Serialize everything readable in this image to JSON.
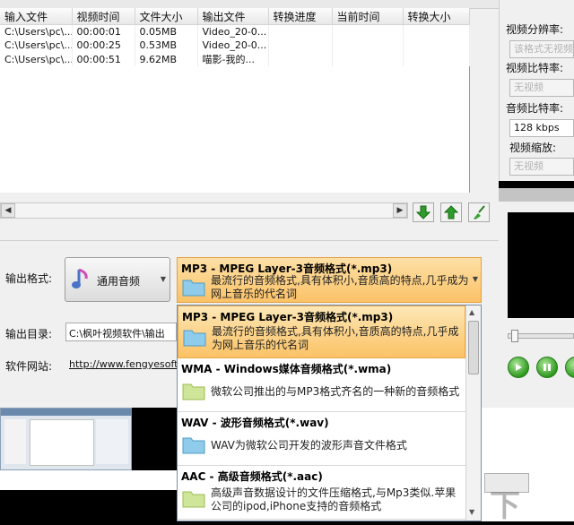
{
  "file_table": {
    "columns": [
      "输入文件",
      "视频时间",
      "文件大小",
      "输出文件",
      "转换进度",
      "当前时间",
      "转换大小"
    ],
    "rows": [
      [
        "C:\\Users\\pc\\...",
        "00:00:01",
        "0.05MB",
        "Video_20-0...",
        "",
        "",
        ""
      ],
      [
        "C:\\Users\\pc\\...",
        "00:00:25",
        "0.53MB",
        "Video_20-0...",
        "",
        "",
        ""
      ],
      [
        "C:\\Users\\pc\\...",
        "00:00:51",
        "9.62MB",
        "喵影-我的...",
        "",
        "",
        ""
      ]
    ]
  },
  "right_panel": {
    "resolution_label": "视频分辨率:",
    "resolution_value": "该格式无视频",
    "video_bitrate_label": "视频比特率:",
    "video_bitrate_value": "无视频",
    "audio_bitrate_label": "音频比特率:",
    "audio_bitrate_value": "128 kbps",
    "video_scale_label": "视频缩放:",
    "video_scale_value": "无视频"
  },
  "output": {
    "format_label": "输出格式:",
    "category_button": "通用音频",
    "selected_format_title": "MP3 - MPEG Layer-3音频格式(*.mp3)",
    "selected_format_desc": "最流行的音频格式,具有体积小,音质高的特点,几乎成为网上音乐的代名词",
    "dir_label": "输出目录:",
    "dir_value": "C:\\枫叶视频软件\\输出",
    "site_label": "软件网站:",
    "site_value": "http://www.fengyesoft.c"
  },
  "format_list": [
    {
      "title": "MP3 - MPEG Layer-3音频格式(*.mp3)",
      "desc": "最流行的音频格式,具有体积小,音质高的特点,几乎成为网上音乐的代名词",
      "selected": true
    },
    {
      "title": "WMA - Windows媒体音频格式(*.wma)",
      "desc": "微软公司推出的与MP3格式齐名的一种新的音频格式",
      "selected": false
    },
    {
      "title": "WAV - 波形音频格式(*.wav)",
      "desc": "WAV为微软公司开发的波形声音文件格式",
      "selected": false
    },
    {
      "title": "AAC - 高级音频格式(*.aac)",
      "desc": "高级声音数据设计的文件压缩格式,与Mp3类似.苹果公司的ipod,iPhone支持的音频格式",
      "selected": false
    }
  ],
  "colors": {
    "accent": "#fbc267",
    "play_green": "#2f9a1f",
    "list_border": "#7a8fa8"
  }
}
